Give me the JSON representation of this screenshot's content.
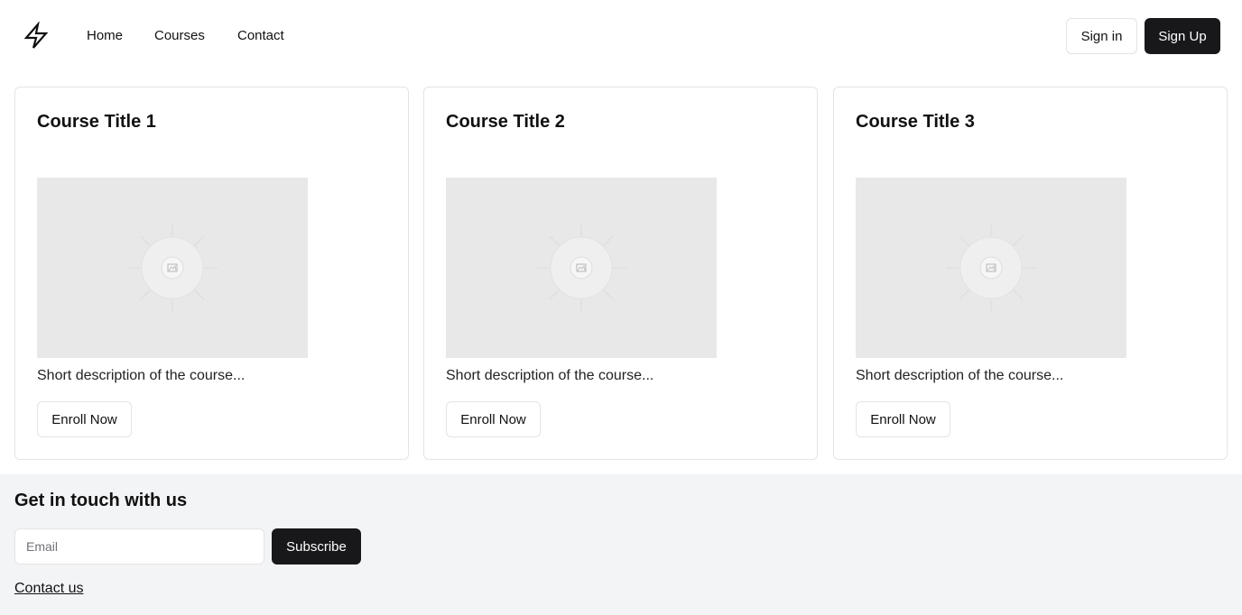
{
  "header": {
    "logo_icon": "lightning-bolt-icon",
    "nav": [
      {
        "label": "Home"
      },
      {
        "label": "Courses"
      },
      {
        "label": "Contact"
      }
    ],
    "sign_in_label": "Sign in",
    "sign_up_label": "Sign Up"
  },
  "courses": [
    {
      "title": "Course Title 1",
      "image_icon": "image-placeholder-icon",
      "description": "Short description of the course...",
      "button_label": "Enroll Now"
    },
    {
      "title": "Course Title 2",
      "image_icon": "image-placeholder-icon",
      "description": "Short description of the course...",
      "button_label": "Enroll Now"
    },
    {
      "title": "Course Title 3",
      "image_icon": "image-placeholder-icon",
      "description": "Short description of the course...",
      "button_label": "Enroll Now"
    }
  ],
  "footer": {
    "title": "Get in touch with us",
    "email_placeholder": "Email",
    "email_value": "",
    "subscribe_label": "Subscribe",
    "contact_link_label": "Contact us"
  },
  "colors": {
    "primary_dark": "#18181b",
    "border": "#e4e4e7",
    "footer_bg": "#f3f4f6",
    "placeholder_bg": "#e8e8e8"
  }
}
